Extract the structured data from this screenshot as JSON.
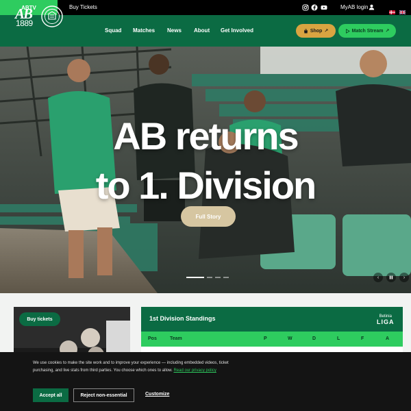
{
  "topbar": {
    "abtv_label": "ABTV",
    "buy_tickets_label": "Buy Tickets",
    "social_icons": [
      "instagram-icon",
      "facebook-icon",
      "youtube-icon"
    ],
    "myab_label": "MyAB login",
    "languages": [
      "Danish",
      "English"
    ]
  },
  "header": {
    "logo_text": "AB",
    "logo_year": "1889",
    "nav": [
      "Squad",
      "Matches",
      "News",
      "About",
      "Get Involved"
    ],
    "shop_label": "Shop",
    "match_stream_label": "Match Stream"
  },
  "hero": {
    "title_line1": "AB returns",
    "title_line2": "to 1. Division",
    "cta_label": "Full Story",
    "slide_count": 4,
    "active_slide": 1
  },
  "tickets_card": {
    "button_label": "Buy tickets"
  },
  "standings": {
    "title": "1st Division Standings",
    "sponsor_line1": "Betinia",
    "sponsor_line2": "LIGA",
    "columns": [
      "Pos",
      "Team",
      "P",
      "W",
      "D",
      "L",
      "F",
      "A"
    ]
  },
  "cookie": {
    "text": "We use cookies to make the site work and to improve your experience — including embedded videos, ticket purchasing, and live stats from third parties. You choose which ones to allow.",
    "link_label": "Read our privacy policy",
    "accept_label": "Accept all",
    "reject_label": "Reject non-essential",
    "customize_label": "Customize"
  },
  "colors": {
    "brand_green": "#0b6b43",
    "accent_green": "#2ecc5f",
    "shop_gold": "#d9a441",
    "cta_beige": "#d6c6a1"
  }
}
